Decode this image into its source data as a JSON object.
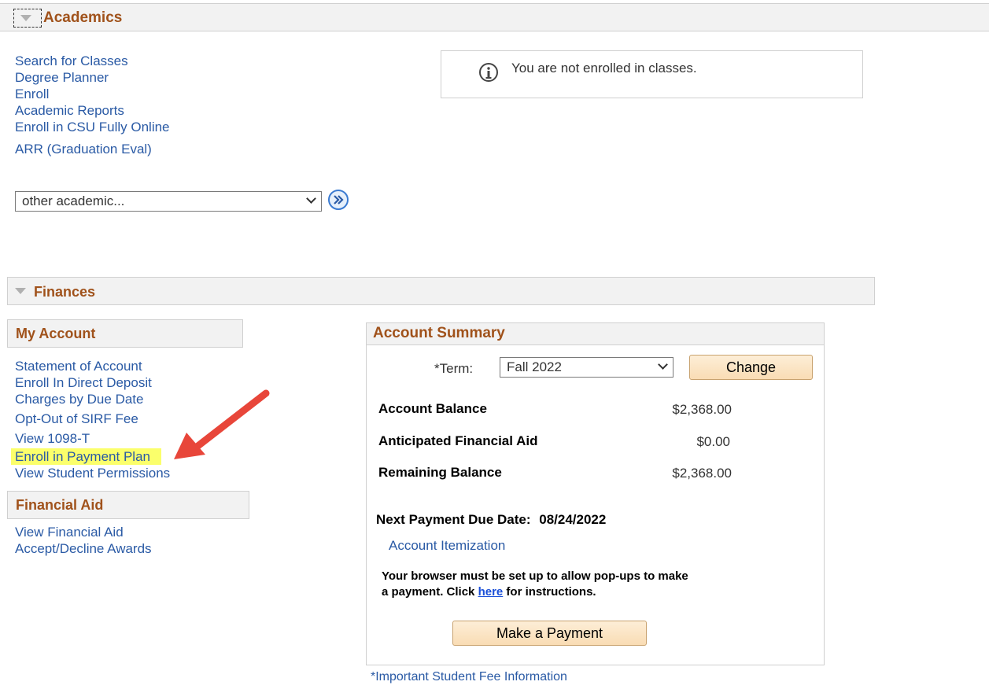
{
  "academics": {
    "title": "Academics",
    "links": [
      "Search for Classes",
      "Degree Planner",
      "Enroll",
      "Academic Reports",
      "Enroll in CSU Fully Online",
      "ARR (Graduation Eval)"
    ],
    "select_value": "other academic...",
    "info_message": "You are not enrolled in classes."
  },
  "finances": {
    "title": "Finances",
    "my_account": {
      "title": "My Account",
      "links": [
        "Statement of Account",
        "Enroll In Direct Deposit",
        "Charges by Due Date",
        "Opt-Out of SIRF Fee",
        "View 1098-T",
        "Enroll in Payment Plan",
        "View Student Permissions"
      ]
    },
    "financial_aid": {
      "title": "Financial Aid",
      "links": [
        "View Financial Aid",
        "Accept/Decline Awards"
      ]
    },
    "account_summary": {
      "title": "Account Summary",
      "term_label": "*Term:",
      "term_value": "Fall 2022",
      "change_label": "Change",
      "rows": [
        {
          "label": "Account Balance",
          "amount": "$2,368.00"
        },
        {
          "label": "Anticipated Financial Aid",
          "amount": "$0.00"
        },
        {
          "label": "Remaining Balance",
          "amount": "$2,368.00"
        }
      ],
      "next_due_label": "Next Payment Due Date:",
      "next_due_date": "08/24/2022",
      "itemization_link": "Account Itemization",
      "popup_text_1": "Your browser must be set up to allow pop-ups to make",
      "popup_text_2": "a payment. Click",
      "popup_here": "here",
      "popup_text_3": "for instructions.",
      "pay_button": "Make a Payment"
    },
    "fee_info_link": "*Important Student Fee Information"
  },
  "colors": {
    "section_title": "#a0521b",
    "link": "#2a5aa5",
    "highlight": "#fbff6b",
    "arrow": "#e8463a"
  }
}
